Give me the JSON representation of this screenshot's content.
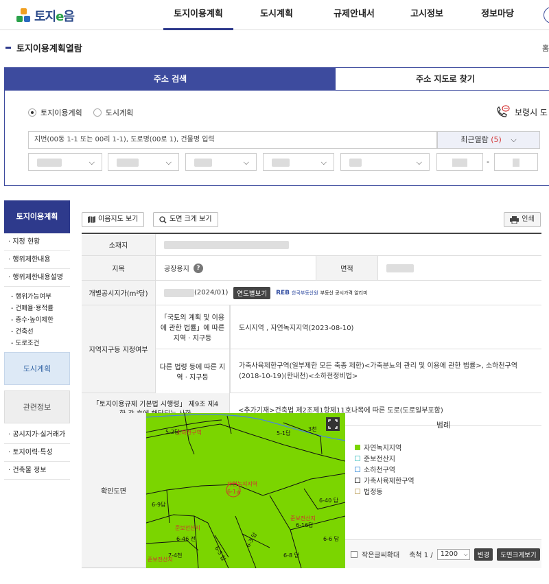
{
  "brand": {
    "logo_text_a": "토지",
    "logo_text_b": "e",
    "logo_text_c": "음"
  },
  "nav": {
    "items": [
      {
        "label": "토지이용계획",
        "active": true
      },
      {
        "label": "도시계획",
        "active": false
      },
      {
        "label": "규제안내서",
        "active": false
      },
      {
        "label": "고시정보",
        "active": false
      },
      {
        "label": "정보마당",
        "active": false
      }
    ]
  },
  "page": {
    "title": "토지이용계획열람",
    "home": "홈"
  },
  "search": {
    "tab_address": "주소 검색",
    "tab_map": "주소 지도로 찾기",
    "radio_landuse": "토지이용계획",
    "radio_city": "도시계획",
    "city_link": "보령시 도",
    "address_placeholder": "지번(00동 1-1 또는 00리 1-1), 도로명(00로 1), 건물명 입력",
    "recent_label": "최근열람",
    "recent_count": "(5)",
    "dash": "-"
  },
  "lnb": {
    "head": "토지이용계획",
    "items": [
      "지정 현황",
      "행위제한내용",
      "행위제한내용설명"
    ],
    "subs": [
      "행위가능여부",
      "건폐율·용적률",
      "층수·높이제한",
      "건축선",
      "도로조건"
    ],
    "city_plan": "도시계획",
    "related": "관련정보",
    "related_items": [
      "공시지가·실거래가",
      "토지이력·특성",
      "건축물 정보"
    ]
  },
  "toolbar": {
    "map_btn": "이음지도 보기",
    "zoom_btn": "도면 크게 보기",
    "print_btn": "인쇄"
  },
  "table": {
    "location_label": "소재지",
    "jimok_label": "지목",
    "jimok_value": "공장용지",
    "area_label": "면적",
    "price_label": "개별공시지가(m²당)",
    "price_date": "(2024/01)",
    "year_btn": "연도별보기",
    "reb_logo": "REB",
    "reb_text": "한국부동산원",
    "reb_service": "부동산 공시가격 알리미",
    "zone_label": "지역지구등 지정여부",
    "law1_label": "「국토의 계획 및 이용에 관한 법률」에 따른 지역 · 지구등",
    "law1_value": "도시지역 , 자연녹지지역(2023-08-10)",
    "law2_label": "다른 법령 등에 따른 지역 · 지구등",
    "law2_value": "가축사육제한구역(일부제한 모든 축종 제한)<가축분뇨의 관리 및 이용에 관한 법률>, 소하천구역(2018-10-19)(한내천)<소하천정비법>",
    "decree_label": "「토지이용규제 기본법 시행령」 제9조 제4항 각 호에 해당되는 사항",
    "decree_value": "<추가기재>건축법 제2조제1항제11호나목에 따른 도로(도로일부포함)",
    "map_label": "확인도면"
  },
  "map": {
    "labels": [
      "5-2답",
      "소하천구역",
      "5-1답",
      "3천",
      "자연녹지지역",
      "6-1공",
      "6-9답",
      "6-40 답",
      "준보전산지",
      "6-16답",
      "준보전산지",
      "6-46 전",
      "6-6 답",
      "7-4천",
      "6-5 답",
      "6-3 답",
      "6-8 답",
      "준보전산지"
    ]
  },
  "legend": {
    "title": "범례",
    "items": [
      {
        "label": "자연녹지지역",
        "color": "#7bd500"
      },
      {
        "label": "준보전산지",
        "color": "#bfe6e6"
      },
      {
        "label": "소하천구역",
        "color": "#5aa0e0"
      },
      {
        "label": "가축사육제한구역",
        "color": "#ffffff"
      },
      {
        "label": "법정동",
        "color": "#e8dcc0"
      }
    ],
    "small_font": "작은글씨확대",
    "scale_label": "축척 1 /",
    "scale_value": "1200",
    "change_btn": "변경",
    "big_btn": "도면크게보기"
  }
}
